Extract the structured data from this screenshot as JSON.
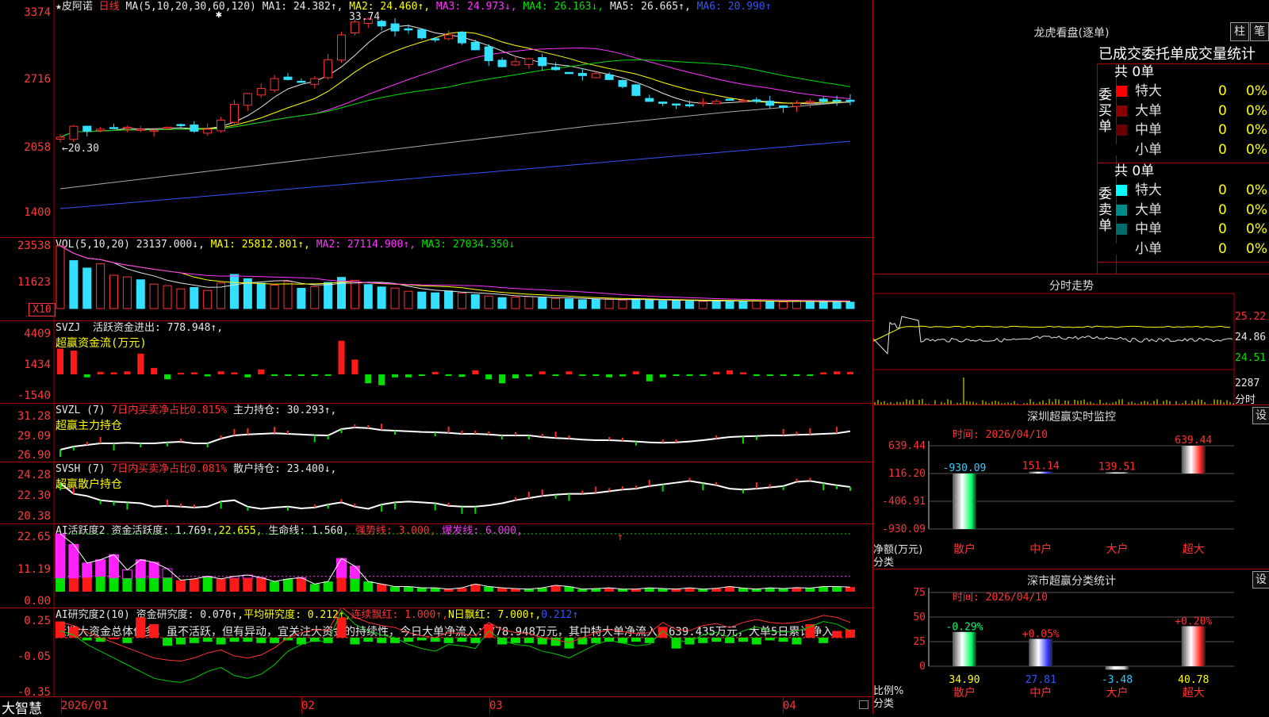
{
  "stock": {
    "name": "皮阿诺",
    "period": "日线"
  },
  "main_header": {
    "ma_def": "MA(5,10,20,30,60,120)",
    "ma1": "MA1: 24.382↑,",
    "ma2": "MA2: 24.460↑,",
    "ma3": "MA3: 24.973↓,",
    "ma4": "MA4: 26.163↓,",
    "ma5": "MA5: 26.665↑,",
    "ma6": "MA6: 20.990↑"
  },
  "main_ticks": [
    "3374",
    "2716",
    "2058",
    "1400"
  ],
  "main_annot": {
    "high": "33.74",
    "low": "20.30",
    "low_arrow": "←"
  },
  "vol_header": {
    "def": "VOL(5,10,20)",
    "vol": "23137.000↓,",
    "ma1": "MA1: 25812.801↑,",
    "ma2": "MA2: 27114.900↑,",
    "ma3": "MA3: 27034.350↓"
  },
  "vol_ticks": [
    "23538",
    "11623"
  ],
  "vol_unit": "X10",
  "svzj": {
    "label": "SVZJ",
    "text": "活跃资金进出: 778.948↑,",
    "sub": "超赢资金流(万元)",
    "ticks": [
      "4409",
      "1434",
      "-1540"
    ]
  },
  "svzl": {
    "label": "SVZL (7)",
    "stat": "7日内买卖净占比0.815%",
    "text": "主力持仓: 30.293↑,",
    "sub": "超赢主力持仓",
    "ticks": [
      "31.28",
      "29.09",
      "26.90"
    ]
  },
  "svsh": {
    "label": "SVSH (7)",
    "stat": "7日内买卖净占比0.081%",
    "text": "散户持仓: 23.400↓,",
    "sub": "超赢散户持仓",
    "ticks": [
      "24.28",
      "22.30",
      "20.38"
    ]
  },
  "ai1": {
    "label": "AI活跃度2",
    "t1": "资金活跃度: 1.769↑,",
    "t2": "22.655,",
    "t3": "生命线: 1.560,",
    "t4": "强势线: 3.000,",
    "t5": "爆发线: 6.000,",
    "ticks": [
      "22.65",
      "11.19",
      "0.00"
    ]
  },
  "ai2": {
    "label": "AI研究度2(10)",
    "t1": "资金研究度: 0.070↑,",
    "t2": "平均研究度: 0.212↑,",
    "t3": "连续飘红: 1.000↑,",
    "t4": "N日飘红: 7.000↑,",
    "t5": "0.212↑",
    "comment": "近期大资金总体偏多，虽不活跃，但有异动，宜关注大资金的持续性，今日大单净流入：778.948万元，其中特大单净流入：639.435万元，大单5日累计净入",
    "ticks": [
      "0.25",
      "-0.05",
      "-0.35"
    ]
  },
  "xaxis": {
    "app": "大智慧",
    "labels": [
      "2026/01",
      "02",
      "03",
      "04"
    ]
  },
  "lhb": {
    "title": "龙虎看盘(逐单)",
    "btn1": "柱",
    "btn2": "笔",
    "heading": "已成交委托单成交量统计",
    "buy": {
      "side": "委买单",
      "total": "共 0单",
      "rows": [
        {
          "label": "特大",
          "val": "0",
          "pct": "0%",
          "color": "#ff0000"
        },
        {
          "label": "大单",
          "val": "0",
          "pct": "0%",
          "color": "#8b0000"
        },
        {
          "label": "中单",
          "val": "0",
          "pct": "0%",
          "color": "#6b0000"
        },
        {
          "label": "小单",
          "val": "0",
          "pct": "0%",
          "color": "#000000"
        }
      ]
    },
    "sell": {
      "side": "委卖单",
      "total": "共 0单",
      "rows": [
        {
          "label": "特大",
          "val": "0",
          "pct": "0%",
          "color": "#00ffff"
        },
        {
          "label": "大单",
          "val": "0",
          "pct": "0%",
          "color": "#008b8b"
        },
        {
          "label": "中单",
          "val": "0",
          "pct": "0%",
          "color": "#006b6b"
        },
        {
          "label": "小单",
          "val": "0",
          "pct": "0%",
          "color": "#000000"
        }
      ]
    }
  },
  "intraday": {
    "title": "分时走势",
    "ticks": [
      "25.22",
      "24.86",
      "24.51"
    ],
    "vol_tick": "2287",
    "vol_label": "分时"
  },
  "sz_monitor": {
    "title": "深圳超赢实时监控",
    "btn": "设",
    "time": "时间: 2026/04/10",
    "ticks": [
      "639.44",
      "116.20",
      "-406.91",
      "-930.09"
    ],
    "ylabel": "净额(万元)",
    "xlabel": "分类",
    "cats": [
      "散户",
      "中户",
      "大户",
      "超大"
    ],
    "values": [
      -930.09,
      151.14,
      139.51,
      639.44
    ],
    "value_labels": [
      "-930.09",
      "151.14",
      "139.51",
      "639.44"
    ]
  },
  "sz_class": {
    "title": "深市超赢分类统计",
    "btn": "设",
    "time": "时间: 2026/04/10",
    "ticks": [
      "75",
      "50",
      "25",
      "0"
    ],
    "ylabel": "比例%",
    "xlabel": "分类",
    "cats": [
      "散户",
      "中户",
      "大户",
      "超大"
    ],
    "values": [
      34.9,
      27.81,
      -3.48,
      40.78
    ],
    "value_labels": [
      "34.90",
      "27.81",
      "-3.48",
      "40.78"
    ],
    "changes": [
      "-0.29%",
      "+0.05%",
      "",
      "+0.20%"
    ]
  }
}
